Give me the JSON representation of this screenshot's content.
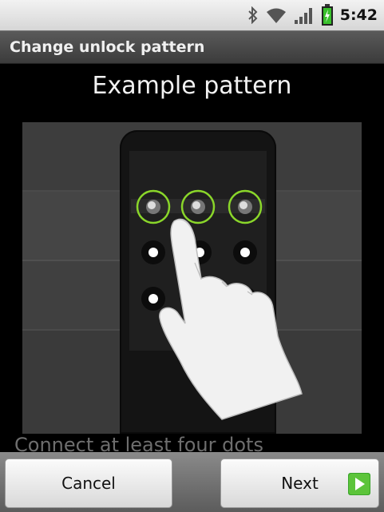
{
  "status_bar": {
    "time": "5:42",
    "icons": [
      "bluetooth-icon",
      "wifi-icon",
      "signal-icon",
      "battery-charging-icon"
    ],
    "battery_color": "#39c12c"
  },
  "title_bar": {
    "title": "Change unlock pattern"
  },
  "main": {
    "heading": "Example pattern",
    "hint": "Connect at least four dots",
    "highlight_color": "#8ad62a"
  },
  "buttons": {
    "cancel_label": "Cancel",
    "next_label": "Next",
    "next_icon": "arrow-right-icon",
    "next_icon_color": "#3aa52a"
  }
}
